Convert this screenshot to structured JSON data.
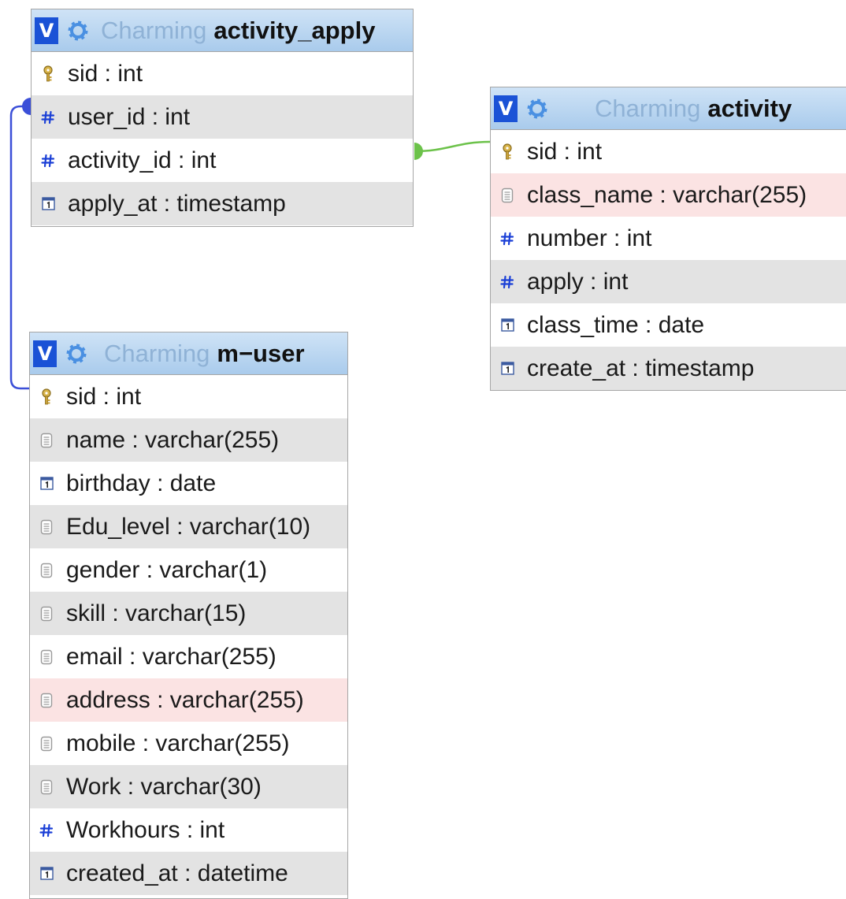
{
  "tables": [
    {
      "id": "activity_apply",
      "db": "Charming",
      "name": "activity_apply",
      "columns": [
        {
          "text": "sid : int",
          "icon": "key-icon",
          "shade": "none"
        },
        {
          "text": "user_id : int",
          "icon": "hash-icon",
          "shade": "alt"
        },
        {
          "text": "activity_id : int",
          "icon": "hash-icon",
          "shade": "none"
        },
        {
          "text": "apply_at : timestamp",
          "icon": "calendar-icon",
          "shade": "alt"
        }
      ]
    },
    {
      "id": "activity",
      "db": "Charming",
      "name": "activity",
      "columns": [
        {
          "text": "sid : int",
          "icon": "key-icon",
          "shade": "none"
        },
        {
          "text": "class_name : varchar(255)",
          "icon": "text-icon",
          "shade": "hl"
        },
        {
          "text": "number : int",
          "icon": "hash-icon",
          "shade": "none"
        },
        {
          "text": "apply : int",
          "icon": "hash-icon",
          "shade": "alt"
        },
        {
          "text": "class_time : date",
          "icon": "calendar-icon",
          "shade": "none"
        },
        {
          "text": "create_at : timestamp",
          "icon": "calendar-icon",
          "shade": "alt"
        }
      ]
    },
    {
      "id": "m_user",
      "db": "Charming",
      "name": "m−user",
      "columns": [
        {
          "text": "sid : int",
          "icon": "key-icon",
          "shade": "none"
        },
        {
          "text": "name : varchar(255)",
          "icon": "text-icon",
          "shade": "alt"
        },
        {
          "text": "birthday : date",
          "icon": "calendar-icon",
          "shade": "none"
        },
        {
          "text": "Edu_level : varchar(10)",
          "icon": "text-icon",
          "shade": "alt"
        },
        {
          "text": "gender : varchar(1)",
          "icon": "text-icon",
          "shade": "none"
        },
        {
          "text": "skill : varchar(15)",
          "icon": "text-icon",
          "shade": "alt"
        },
        {
          "text": "email : varchar(255)",
          "icon": "text-icon",
          "shade": "none"
        },
        {
          "text": "address : varchar(255)",
          "icon": "text-icon",
          "shade": "hl"
        },
        {
          "text": "mobile : varchar(255)",
          "icon": "text-icon",
          "shade": "none"
        },
        {
          "text": "Work : varchar(30)",
          "icon": "text-icon",
          "shade": "alt"
        },
        {
          "text": "Workhours : int",
          "icon": "hash-icon",
          "shade": "none"
        },
        {
          "text": "created_at : datetime",
          "icon": "calendar-icon",
          "shade": "alt"
        }
      ]
    }
  ],
  "header": {
    "toggle_label": "V"
  },
  "relations": [
    {
      "from": "activity_apply.user_id",
      "to": "m_user.sid",
      "color": "#3b4fd8"
    },
    {
      "from": "activity_apply.activity_id",
      "to": "activity.sid",
      "color": "#6cc24a"
    }
  ],
  "colors": {
    "header_top": "#cfe3f6",
    "header_bottom": "#a9cbec",
    "toggle": "#1a52d6",
    "gear": "#4a90e2",
    "db_name": "#8fb2d6",
    "row_alt": "#e3e3e3",
    "row_highlight": "#fbe3e3"
  }
}
